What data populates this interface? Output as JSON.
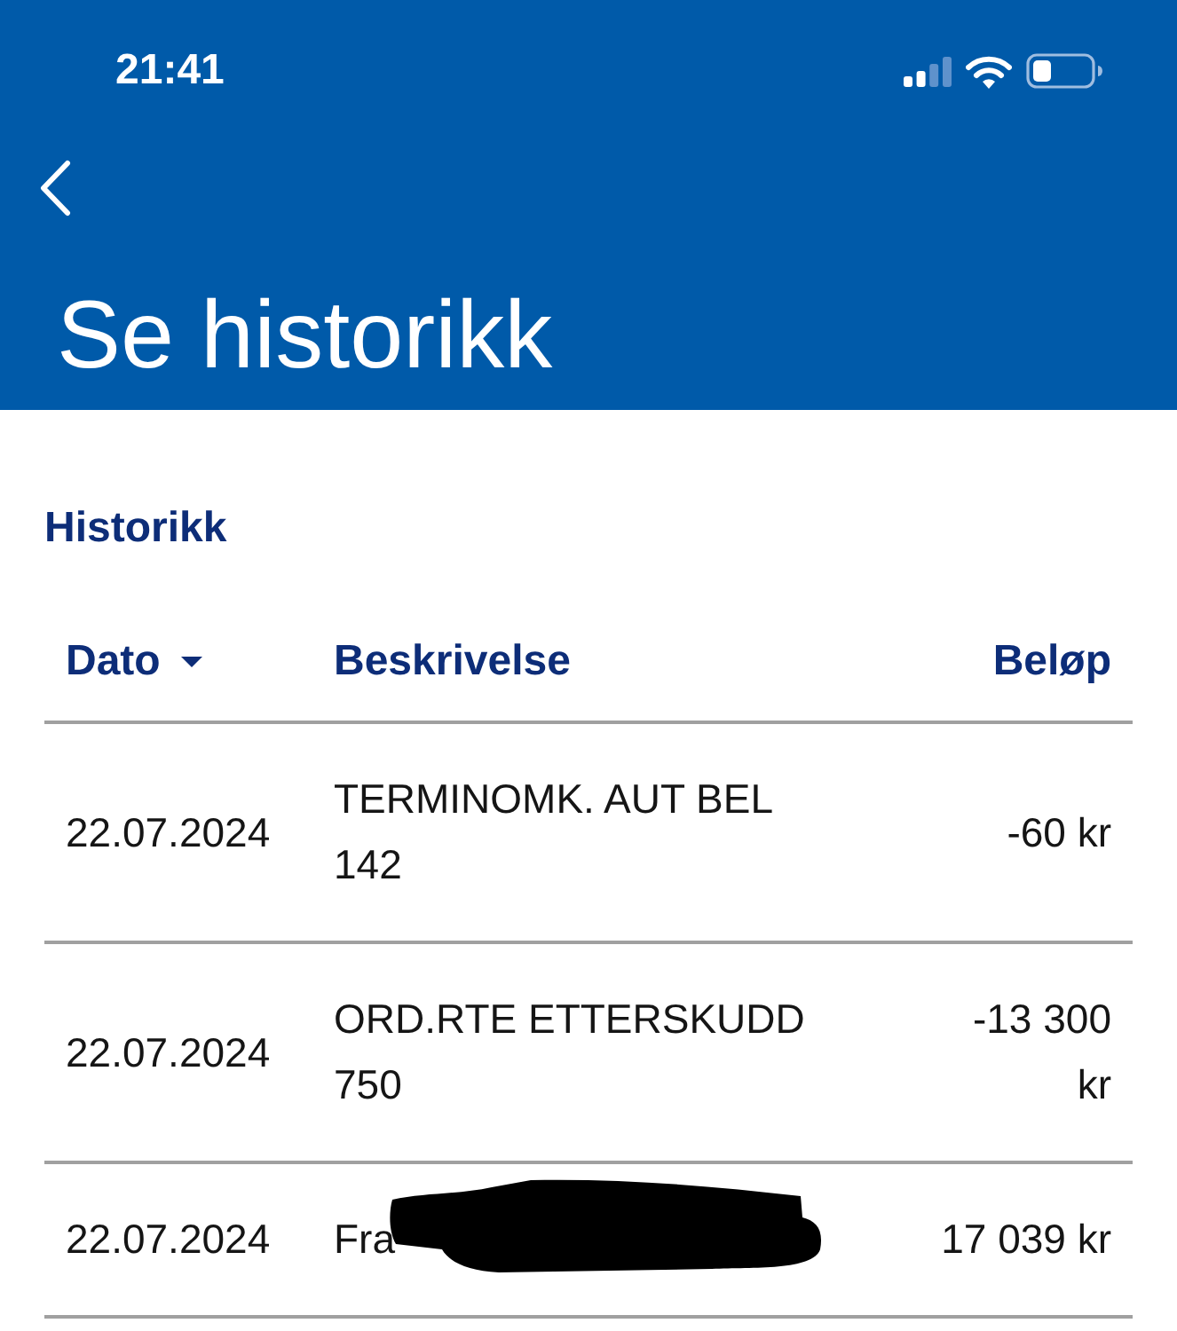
{
  "status_bar": {
    "time": "21:41"
  },
  "header": {
    "title": "Se historikk"
  },
  "section": {
    "title": "Historikk"
  },
  "table": {
    "columns": [
      {
        "label": "Dato",
        "kind": "date",
        "sorted": true
      },
      {
        "label": "Beskrivelse",
        "kind": "text",
        "sorted": false
      },
      {
        "label": "Beløp",
        "kind": "amount",
        "sorted": false
      }
    ],
    "rows": [
      {
        "date": "22.07.2024",
        "description": "TERMINOMK. AUT BEL 142",
        "amount": "-60 kr",
        "redacted": false
      },
      {
        "date": "22.07.2024",
        "description": "ORD.RTE ETTERSKUDD 750",
        "amount": "-13 300 kr",
        "redacted": false
      },
      {
        "date": "22.07.2024",
        "description": "Fra",
        "amount": "17 039 kr",
        "redacted": true
      }
    ]
  }
}
